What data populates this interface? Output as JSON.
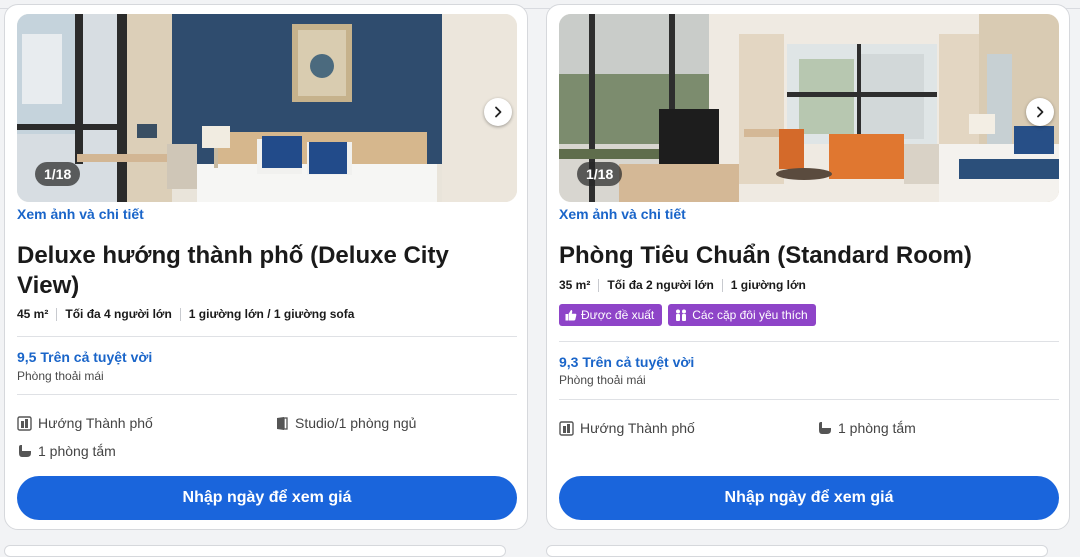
{
  "rooms": [
    {
      "photo_counter": "1/18",
      "photo_link": "Xem ảnh và chi tiết",
      "title": "Deluxe hướng thành phố (Deluxe City View)",
      "area": "45 m²",
      "max_guests": "Tối đa 4 người lớn",
      "beds": "1 giường lớn / 1 giường sofa",
      "score_text": "9,5 Trên cả tuyệt vời",
      "score_sub": "Phòng thoải mái",
      "amenities": [
        "Hướng Thành phố",
        "Studio/1 phòng ngủ",
        "1 phòng tắm"
      ],
      "cta": "Nhập ngày để xem giá"
    },
    {
      "photo_counter": "1/18",
      "photo_link": "Xem ảnh và chi tiết",
      "title": "Phòng Tiêu Chuẩn (Standard Room)",
      "area": "35 m²",
      "max_guests": "Tối đa 2 người lớn",
      "beds": "1 giường lớn",
      "badges": [
        "Được đề xuất",
        "Các cặp đôi yêu thích"
      ],
      "score_text": "9,3 Trên cả tuyệt vời",
      "score_sub": "Phòng thoải mái",
      "amenities": [
        "Hướng Thành phố",
        "1 phòng tắm"
      ],
      "cta": "Nhập ngày để xem giá"
    }
  ],
  "colors": {
    "link_blue": "#1a65c9",
    "button_blue": "#1a65dc",
    "badge_purple": "#8e44c8"
  },
  "icons": [
    "chevron-right-icon",
    "city-view-icon",
    "room-type-icon",
    "bathtub-icon",
    "thumbs-up-icon",
    "couple-icon"
  ]
}
